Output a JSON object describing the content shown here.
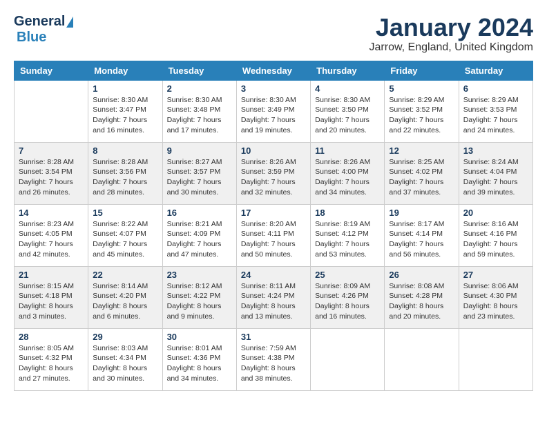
{
  "logo": {
    "general": "General",
    "blue": "Blue"
  },
  "header": {
    "month": "January 2024",
    "location": "Jarrow, England, United Kingdom"
  },
  "weekdays": [
    "Sunday",
    "Monday",
    "Tuesday",
    "Wednesday",
    "Thursday",
    "Friday",
    "Saturday"
  ],
  "weeks": [
    [
      {
        "day": "",
        "sunrise": "",
        "sunset": "",
        "daylight": ""
      },
      {
        "day": "1",
        "sunrise": "Sunrise: 8:30 AM",
        "sunset": "Sunset: 3:47 PM",
        "daylight": "Daylight: 7 hours and 16 minutes."
      },
      {
        "day": "2",
        "sunrise": "Sunrise: 8:30 AM",
        "sunset": "Sunset: 3:48 PM",
        "daylight": "Daylight: 7 hours and 17 minutes."
      },
      {
        "day": "3",
        "sunrise": "Sunrise: 8:30 AM",
        "sunset": "Sunset: 3:49 PM",
        "daylight": "Daylight: 7 hours and 19 minutes."
      },
      {
        "day": "4",
        "sunrise": "Sunrise: 8:30 AM",
        "sunset": "Sunset: 3:50 PM",
        "daylight": "Daylight: 7 hours and 20 minutes."
      },
      {
        "day": "5",
        "sunrise": "Sunrise: 8:29 AM",
        "sunset": "Sunset: 3:52 PM",
        "daylight": "Daylight: 7 hours and 22 minutes."
      },
      {
        "day": "6",
        "sunrise": "Sunrise: 8:29 AM",
        "sunset": "Sunset: 3:53 PM",
        "daylight": "Daylight: 7 hours and 24 minutes."
      }
    ],
    [
      {
        "day": "7",
        "sunrise": "Sunrise: 8:28 AM",
        "sunset": "Sunset: 3:54 PM",
        "daylight": "Daylight: 7 hours and 26 minutes."
      },
      {
        "day": "8",
        "sunrise": "Sunrise: 8:28 AM",
        "sunset": "Sunset: 3:56 PM",
        "daylight": "Daylight: 7 hours and 28 minutes."
      },
      {
        "day": "9",
        "sunrise": "Sunrise: 8:27 AM",
        "sunset": "Sunset: 3:57 PM",
        "daylight": "Daylight: 7 hours and 30 minutes."
      },
      {
        "day": "10",
        "sunrise": "Sunrise: 8:26 AM",
        "sunset": "Sunset: 3:59 PM",
        "daylight": "Daylight: 7 hours and 32 minutes."
      },
      {
        "day": "11",
        "sunrise": "Sunrise: 8:26 AM",
        "sunset": "Sunset: 4:00 PM",
        "daylight": "Daylight: 7 hours and 34 minutes."
      },
      {
        "day": "12",
        "sunrise": "Sunrise: 8:25 AM",
        "sunset": "Sunset: 4:02 PM",
        "daylight": "Daylight: 7 hours and 37 minutes."
      },
      {
        "day": "13",
        "sunrise": "Sunrise: 8:24 AM",
        "sunset": "Sunset: 4:04 PM",
        "daylight": "Daylight: 7 hours and 39 minutes."
      }
    ],
    [
      {
        "day": "14",
        "sunrise": "Sunrise: 8:23 AM",
        "sunset": "Sunset: 4:05 PM",
        "daylight": "Daylight: 7 hours and 42 minutes."
      },
      {
        "day": "15",
        "sunrise": "Sunrise: 8:22 AM",
        "sunset": "Sunset: 4:07 PM",
        "daylight": "Daylight: 7 hours and 45 minutes."
      },
      {
        "day": "16",
        "sunrise": "Sunrise: 8:21 AM",
        "sunset": "Sunset: 4:09 PM",
        "daylight": "Daylight: 7 hours and 47 minutes."
      },
      {
        "day": "17",
        "sunrise": "Sunrise: 8:20 AM",
        "sunset": "Sunset: 4:11 PM",
        "daylight": "Daylight: 7 hours and 50 minutes."
      },
      {
        "day": "18",
        "sunrise": "Sunrise: 8:19 AM",
        "sunset": "Sunset: 4:12 PM",
        "daylight": "Daylight: 7 hours and 53 minutes."
      },
      {
        "day": "19",
        "sunrise": "Sunrise: 8:17 AM",
        "sunset": "Sunset: 4:14 PM",
        "daylight": "Daylight: 7 hours and 56 minutes."
      },
      {
        "day": "20",
        "sunrise": "Sunrise: 8:16 AM",
        "sunset": "Sunset: 4:16 PM",
        "daylight": "Daylight: 7 hours and 59 minutes."
      }
    ],
    [
      {
        "day": "21",
        "sunrise": "Sunrise: 8:15 AM",
        "sunset": "Sunset: 4:18 PM",
        "daylight": "Daylight: 8 hours and 3 minutes."
      },
      {
        "day": "22",
        "sunrise": "Sunrise: 8:14 AM",
        "sunset": "Sunset: 4:20 PM",
        "daylight": "Daylight: 8 hours and 6 minutes."
      },
      {
        "day": "23",
        "sunrise": "Sunrise: 8:12 AM",
        "sunset": "Sunset: 4:22 PM",
        "daylight": "Daylight: 8 hours and 9 minutes."
      },
      {
        "day": "24",
        "sunrise": "Sunrise: 8:11 AM",
        "sunset": "Sunset: 4:24 PM",
        "daylight": "Daylight: 8 hours and 13 minutes."
      },
      {
        "day": "25",
        "sunrise": "Sunrise: 8:09 AM",
        "sunset": "Sunset: 4:26 PM",
        "daylight": "Daylight: 8 hours and 16 minutes."
      },
      {
        "day": "26",
        "sunrise": "Sunrise: 8:08 AM",
        "sunset": "Sunset: 4:28 PM",
        "daylight": "Daylight: 8 hours and 20 minutes."
      },
      {
        "day": "27",
        "sunrise": "Sunrise: 8:06 AM",
        "sunset": "Sunset: 4:30 PM",
        "daylight": "Daylight: 8 hours and 23 minutes."
      }
    ],
    [
      {
        "day": "28",
        "sunrise": "Sunrise: 8:05 AM",
        "sunset": "Sunset: 4:32 PM",
        "daylight": "Daylight: 8 hours and 27 minutes."
      },
      {
        "day": "29",
        "sunrise": "Sunrise: 8:03 AM",
        "sunset": "Sunset: 4:34 PM",
        "daylight": "Daylight: 8 hours and 30 minutes."
      },
      {
        "day": "30",
        "sunrise": "Sunrise: 8:01 AM",
        "sunset": "Sunset: 4:36 PM",
        "daylight": "Daylight: 8 hours and 34 minutes."
      },
      {
        "day": "31",
        "sunrise": "Sunrise: 7:59 AM",
        "sunset": "Sunset: 4:38 PM",
        "daylight": "Daylight: 8 hours and 38 minutes."
      },
      {
        "day": "",
        "sunrise": "",
        "sunset": "",
        "daylight": ""
      },
      {
        "day": "",
        "sunrise": "",
        "sunset": "",
        "daylight": ""
      },
      {
        "day": "",
        "sunrise": "",
        "sunset": "",
        "daylight": ""
      }
    ]
  ]
}
